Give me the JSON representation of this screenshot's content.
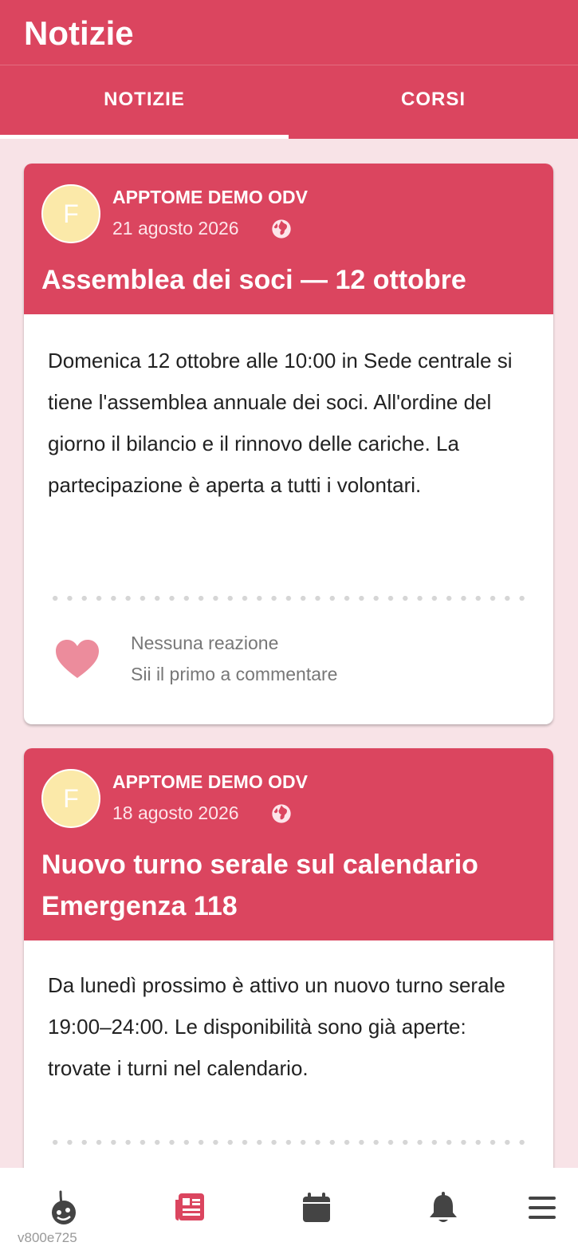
{
  "appbar": {
    "title": "Notizie"
  },
  "tabs": [
    {
      "label": "NOTIZIE",
      "active": true
    },
    {
      "label": "CORSI",
      "active": false
    }
  ],
  "posts": [
    {
      "avatar_letter": "F",
      "org": "APPTOME DEMO ODV",
      "date": "21 agosto 2026",
      "visibility_icon": "globe-icon",
      "title": "Assemblea dei soci — 12 ottobre",
      "body": "Domenica 12 ottobre alle 10:00 in Sede centrale si tiene l'assemblea annuale dei soci. All'ordine del giorno il bilancio e il rinnovo delle cariche. La partecipazione è aperta a tutti i volontari.",
      "reactions": "Nessuna reazione",
      "comments": "Sii il primo a commentare"
    },
    {
      "avatar_letter": "F",
      "org": "APPTOME DEMO ODV",
      "date": "18 agosto 2026",
      "visibility_icon": "globe-icon",
      "title": "Nuovo turno serale sul calendario Emergenza 118",
      "body": "Da lunedì prossimo è attivo un nuovo turno serale 19:00–24:00. Le disponibilità sono già aperte: trovate i turni nel calendario."
    }
  ],
  "bottom_nav": [
    {
      "icon": "home-logo-icon"
    },
    {
      "icon": "news-icon",
      "active": true
    },
    {
      "icon": "calendar-icon"
    },
    {
      "icon": "bell-icon"
    },
    {
      "icon": "menu-icon"
    }
  ],
  "version": "v800e725",
  "colors": {
    "primary": "#db455f",
    "background": "#f8e3e7",
    "avatar": "#fbe9a9",
    "heart": "#ec8c9c",
    "nav_inactive": "#444444"
  }
}
